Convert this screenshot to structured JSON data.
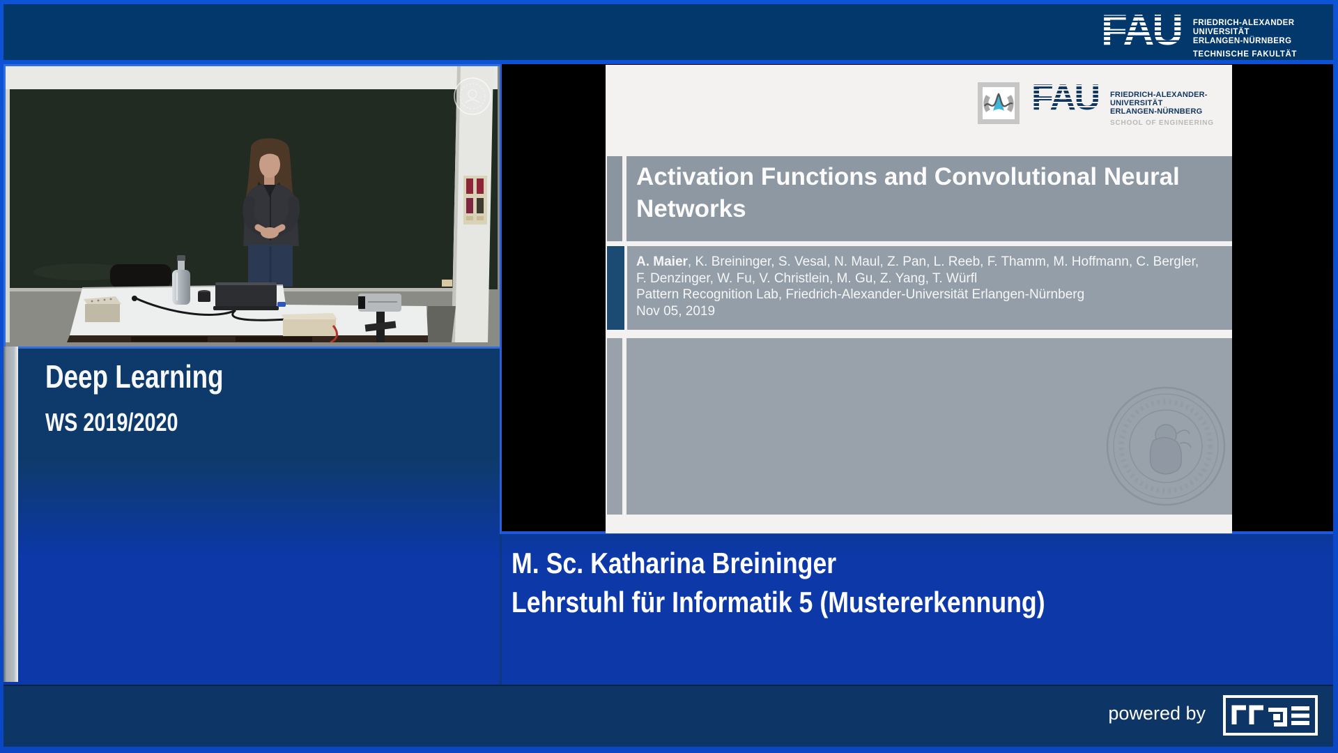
{
  "header": {
    "fau": {
      "letters": "FAU",
      "line1": "FRIEDRICH-ALEXANDER",
      "line2": "UNIVERSITÄT",
      "line3": "ERLANGEN-NÜRNBERG",
      "faculty": "TECHNISCHE FAKULTÄT"
    }
  },
  "course": {
    "title": "Deep Learning",
    "term": "WS 2019/2020"
  },
  "slide": {
    "fau": {
      "letters": "FAU",
      "line1": "FRIEDRICH-ALEXANDER-",
      "line2": "UNIVERSITÄT",
      "line3": "ERLANGEN-NÜRNBERG",
      "school": "SCHOOL OF ENGINEERING"
    },
    "title_line1": "Activation Functions and Convolutional Neural",
    "title_line2": "Networks",
    "authors_bold": "A. Maier",
    "authors_rest": ", K. Breininger, S. Vesal, N. Maul, Z. Pan, L. Reeb, F. Thamm, M. Hoffmann, C. Bergler,",
    "authors_line2": "F. Denzinger, W. Fu, V. Christlein, M. Gu, Z. Yang, T. Würfl",
    "affiliation": "Pattern Recognition Lab, Friedrich-Alexander-Universität Erlangen-Nürnberg",
    "date": "Nov 05, 2019"
  },
  "speaker": {
    "name": "M. Sc. Katharina Breininger",
    "department": "Lehrstuhl für Informatik 5 (Mustererkennung)"
  },
  "footer": {
    "powered_by": "powered by"
  },
  "colors": {
    "frame_blue": "#0d53d6",
    "topbar_navy": "#03386c",
    "panel_royal_blue": "#0c38a8",
    "panel_navy": "#0e3a6b",
    "bottombar_navy": "#0d3566",
    "slide_band_gray": "#8d98a3",
    "slide_accent_navy": "#1b4a72",
    "blackboard_green": "#212b21",
    "video_border_blue": "#2e6ee0"
  }
}
